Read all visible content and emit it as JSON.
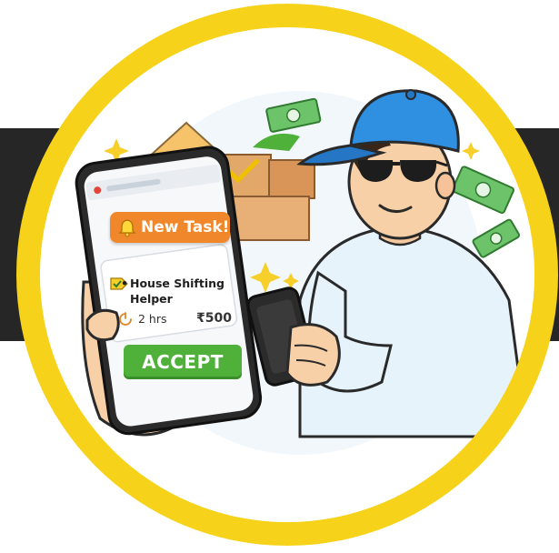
{
  "notification": {
    "badge_text": "New Task!"
  },
  "task": {
    "title": "House Shifting Helper",
    "duration": "2 hrs",
    "price": "₹500",
    "accept_label": "ACCEPT"
  },
  "colors": {
    "ring": "#f7d21a",
    "band": "#262626",
    "badge": "#f0872a",
    "accept": "#4fb13a",
    "cap": "#2f8fe0",
    "shirt": "#e6f3fb"
  },
  "icons": [
    "bell-icon",
    "task-tag-icon",
    "clock-icon",
    "house-icon",
    "boxes-icon",
    "cash-icon",
    "sparkle-icon",
    "sunglasses-icon"
  ]
}
